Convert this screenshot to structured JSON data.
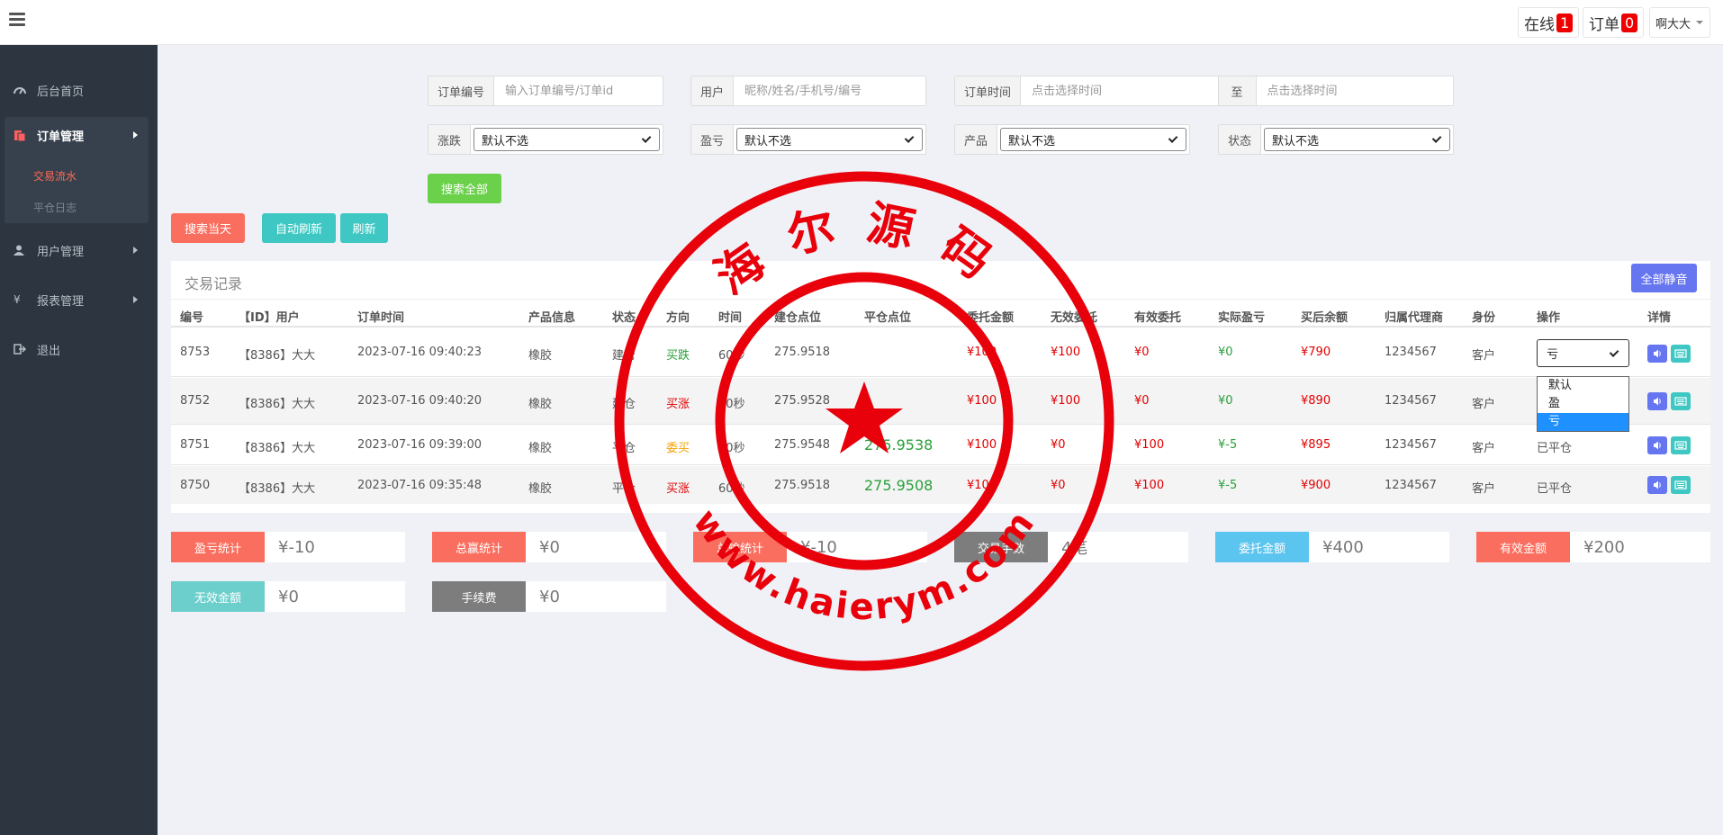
{
  "topbar": {
    "online_label": "在线",
    "online_count": "1",
    "orders_label": "订单",
    "orders_count": "0",
    "user_name": "啊大大"
  },
  "sidebar": {
    "items": [
      {
        "label": "后台首页",
        "icon": "dashboard-icon"
      },
      {
        "label": "订单管理",
        "icon": "orders-icon"
      },
      {
        "label": "用户管理",
        "icon": "user-icon"
      },
      {
        "label": "报表管理",
        "icon": "yen-icon"
      },
      {
        "label": "退出",
        "icon": "logout-icon"
      }
    ],
    "sub_items": [
      "交易流水",
      "平仓日志"
    ]
  },
  "search": {
    "order_no_label": "订单编号",
    "order_no_placeholder": "输入订单编号/订单id",
    "user_label": "用户",
    "user_placeholder": "昵称/姓名/手机号/编号",
    "time_label": "订单时间",
    "time_placeholder": "点击选择时间",
    "to_label": "至",
    "time_end_placeholder": "点击选择时间",
    "rise_fall_label": "涨跌",
    "rise_fall_value": "默认不选",
    "profit_label": "盈亏",
    "profit_value": "默认不选",
    "product_label": "产品",
    "product_value": "默认不选",
    "status_label": "状态",
    "status_value": "默认不选",
    "search_all": "搜索全部",
    "search_today": "搜索当天",
    "auto_refresh": "自动刷新",
    "refresh": "刷新"
  },
  "table": {
    "title": "交易记录",
    "mute_all": "全部静音",
    "headers": [
      "编号",
      "【ID】用户",
      "订单时间",
      "产品信息",
      "状态",
      "方向",
      "时间",
      "建仓点位",
      "平仓点位",
      "委托金额",
      "无效委托",
      "有效委托",
      "实际盈亏",
      "买后余额",
      "归属代理商",
      "身份",
      "操作",
      "详情"
    ],
    "rows": [
      {
        "id": "8753",
        "user": "【8386】大大",
        "time": "2023-07-16 09:40:23",
        "product": "橡胶",
        "status": "建仓",
        "direction": "买跌",
        "duration": "60秒",
        "open": "275.9518",
        "close": "",
        "amount": "¥100",
        "invalid": "¥100",
        "valid": "¥0",
        "pnl": "¥0",
        "balance": "¥790",
        "agent": "1234567",
        "role": "客户",
        "op": "亏"
      },
      {
        "id": "8752",
        "user": "【8386】大大",
        "time": "2023-07-16 09:40:20",
        "product": "橡胶",
        "status": "建仓",
        "direction": "买涨",
        "duration": "60秒",
        "open": "275.9528",
        "close": "",
        "amount": "¥100",
        "invalid": "¥100",
        "valid": "¥0",
        "pnl": "¥0",
        "balance": "¥890",
        "agent": "1234567",
        "role": "客户",
        "op": ""
      },
      {
        "id": "8751",
        "user": "【8386】大大",
        "time": "2023-07-16 09:39:00",
        "product": "橡胶",
        "status": "平仓",
        "direction": "委买",
        "duration": "60秒",
        "open": "275.9548",
        "close": "275.9538",
        "amount": "¥100",
        "invalid": "¥0",
        "valid": "¥100",
        "pnl": "¥-5",
        "balance": "¥895",
        "agent": "1234567",
        "role": "客户",
        "op": "已平仓"
      },
      {
        "id": "8750",
        "user": "【8386】大大",
        "time": "2023-07-16 09:35:48",
        "product": "橡胶",
        "status": "平仓",
        "direction": "买涨",
        "duration": "60秒",
        "open": "275.9518",
        "close": "275.9508",
        "amount": "¥100",
        "invalid": "¥0",
        "valid": "¥100",
        "pnl": "¥-5",
        "balance": "¥900",
        "agent": "1234567",
        "role": "客户",
        "op": "已平仓"
      }
    ],
    "dropdown_options": [
      "默认",
      "盈",
      "亏"
    ]
  },
  "stats": [
    {
      "label": "盈亏统计",
      "value": "¥-10"
    },
    {
      "label": "总赢统计",
      "value": "¥0"
    },
    {
      "label": "总输统计",
      "value": "¥-10"
    },
    {
      "label": "交易手数",
      "value": "4笔"
    },
    {
      "label": "委托金额",
      "value": "¥400"
    },
    {
      "label": "有效金额",
      "value": "¥200"
    },
    {
      "label": "无效金额",
      "value": "¥0"
    },
    {
      "label": "手续费",
      "value": "¥0"
    }
  ],
  "stamp": {
    "top_text": "海尔源码",
    "bottom_text": "www.haierym.com"
  },
  "colors": {
    "sidebar_bg": "#2c3540",
    "accent_red": "#e30000",
    "profit_green": "#2a9f3a",
    "stamp_red": "#e8000b"
  }
}
